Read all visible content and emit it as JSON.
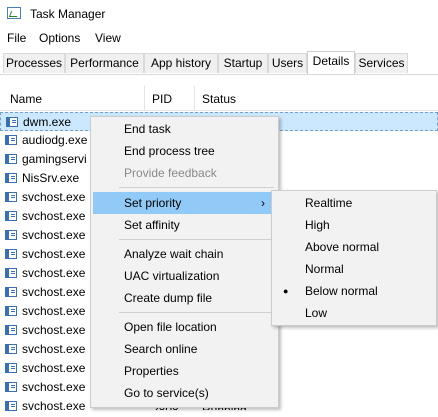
{
  "window": {
    "title": "Task Manager"
  },
  "menubar": [
    "File",
    "Options",
    "View"
  ],
  "tabs": [
    "Processes",
    "Performance",
    "App history",
    "Startup",
    "Users",
    "Details",
    "Services"
  ],
  "active_tab": "Details",
  "columns": {
    "name": "Name",
    "pid": "PID",
    "status": "Status"
  },
  "processes": [
    "dwm.exe",
    "audiodg.exe",
    "gamingservi",
    "NisSrv.exe",
    "svchost.exe",
    "svchost.exe",
    "svchost.exe",
    "svchost.exe",
    "svchost.exe",
    "svchost.exe",
    "svchost.exe",
    "svchost.exe",
    "svchost.exe",
    "svchost.exe",
    "svchost.exe",
    "svchost.exe"
  ],
  "last_row": {
    "pid": "2808",
    "status": "Running"
  },
  "context_menu": [
    "End task",
    "End process tree",
    "Provide feedback",
    "Set priority",
    "Set affinity",
    "Analyze wait chain",
    "UAC virtualization",
    "Create dump file",
    "Open file location",
    "Search online",
    "Properties",
    "Go to service(s)"
  ],
  "priority_menu": [
    "Realtime",
    "High",
    "Above normal",
    "Normal",
    "Below normal",
    "Low"
  ],
  "priority_selected": "Below normal",
  "colors": {
    "selection": "#cce8ff",
    "menu_hover": "#91c9f7"
  }
}
